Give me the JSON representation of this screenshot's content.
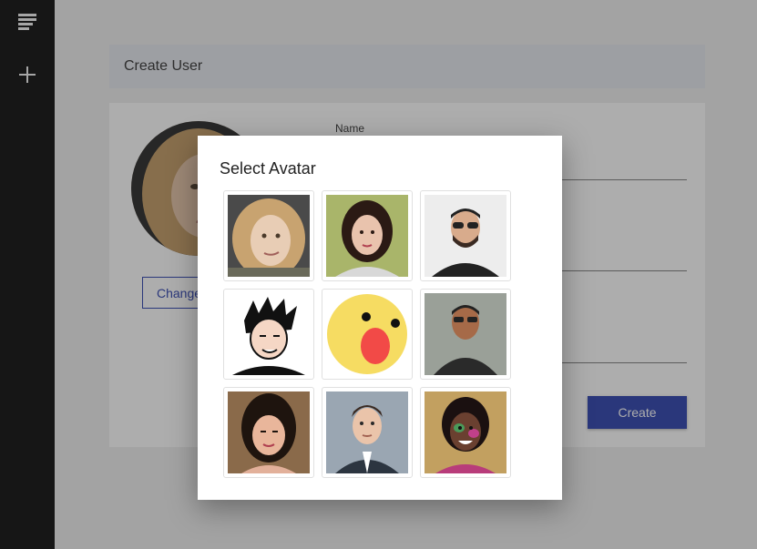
{
  "sidebar": {
    "menu_icon": "menu-icon",
    "add_icon": "plus-icon"
  },
  "header": {
    "title": "Create User"
  },
  "form": {
    "name_label": "Name",
    "change_label": "Change",
    "create_label": "Create"
  },
  "dialog": {
    "title": "Select Avatar",
    "avatars": [
      "avatar-woman-blonde-curly",
      "avatar-woman-dark-hair",
      "avatar-man-sunglasses-beard",
      "avatar-man-cartoon",
      "avatar-emoji-surprised",
      "avatar-man-sunglasses-outdoor",
      "avatar-woman-asian",
      "avatar-man-suit",
      "avatar-woman-painted-face"
    ]
  },
  "colors": {
    "sidebar": "#212121",
    "primary": "#3f51b5",
    "header_bg": "#e8eaf0"
  }
}
